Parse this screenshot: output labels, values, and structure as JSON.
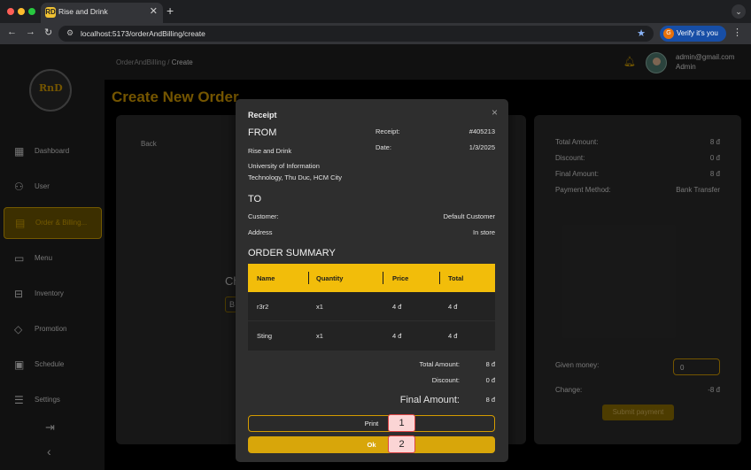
{
  "browser": {
    "tab_title": "Rise and Drink",
    "tab_favicon": "RD",
    "new_tab": "+",
    "url": "localhost:5173/orderAndBilling/create",
    "verify_label": "Verify it's you",
    "verify_icon": "G"
  },
  "sidebar": {
    "logo_text": "RnD",
    "items": [
      {
        "label": "Dashboard",
        "icon": "grid-icon"
      },
      {
        "label": "User",
        "icon": "users-icon"
      },
      {
        "label": "Order & Billing...",
        "icon": "receipt-icon"
      },
      {
        "label": "Menu",
        "icon": "book-icon"
      },
      {
        "label": "Inventory",
        "icon": "box-icon"
      },
      {
        "label": "Promotion",
        "icon": "tag-icon"
      },
      {
        "label": "Schedule",
        "icon": "calendar-icon"
      },
      {
        "label": "Settings",
        "icon": "sliders-icon"
      }
    ]
  },
  "topbar": {
    "crumb_root": "OrderAndBilling",
    "crumb_sep": "/",
    "crumb_current": "Create",
    "user_email": "admin@gmail.com",
    "user_role": "Admin"
  },
  "page": {
    "title": "Create New Order",
    "back_label": "Back",
    "ghost_a": "Ch",
    "ghost_b": "B"
  },
  "summary": {
    "total_amount_label": "Total Amount:",
    "total_amount": "8 đ",
    "discount_label": "Discount:",
    "discount": "0 đ",
    "final_amount_label": "Final Amount:",
    "final_amount": "8 đ",
    "payment_method_label": "Payment Method:",
    "payment_method": "Bank Transfer",
    "given_money_label": "Given money:",
    "given_money": "0",
    "change_label": "Change:",
    "change": "-8 đ",
    "submit_label": "Submit payment"
  },
  "modal": {
    "title": "Receipt",
    "close": "×",
    "from_heading": "FROM",
    "receipt_label": "Receipt:",
    "receipt_value": "#405213",
    "date_label": "Date:",
    "date_value": "1/3/2025",
    "store_name": "Rise and Drink",
    "address_line1": "University of Information",
    "address_line2": "Technology, Thu Duc, HCM City",
    "to_heading": "TO",
    "customer_label": "Customer:",
    "customer_value": "Default Customer",
    "address_label": "Address",
    "address_value": "In store",
    "summary_heading": "ORDER SUMMARY",
    "columns": [
      "Name",
      "Quantity",
      "Price",
      "Total"
    ],
    "rows": [
      {
        "name": "r3r2",
        "qty": "x1",
        "price": "4 đ",
        "total": "4 đ"
      },
      {
        "name": "Sting",
        "qty": "x1",
        "price": "4 đ",
        "total": "4 đ"
      }
    ],
    "total_amount_label": "Total Amount:",
    "total_amount": "8 đ",
    "discount_label": "Discount:",
    "discount": "0 đ",
    "final_amount_label": "Final Amount:",
    "final_amount": "8 đ",
    "print_label": "Print",
    "ok_label": "Ok"
  },
  "annotations": {
    "badge1": "1",
    "badge2": "2"
  },
  "colors": {
    "accent": "#d49b00",
    "table_header": "#f2bd0a",
    "ok_button": "#d8a60a"
  }
}
